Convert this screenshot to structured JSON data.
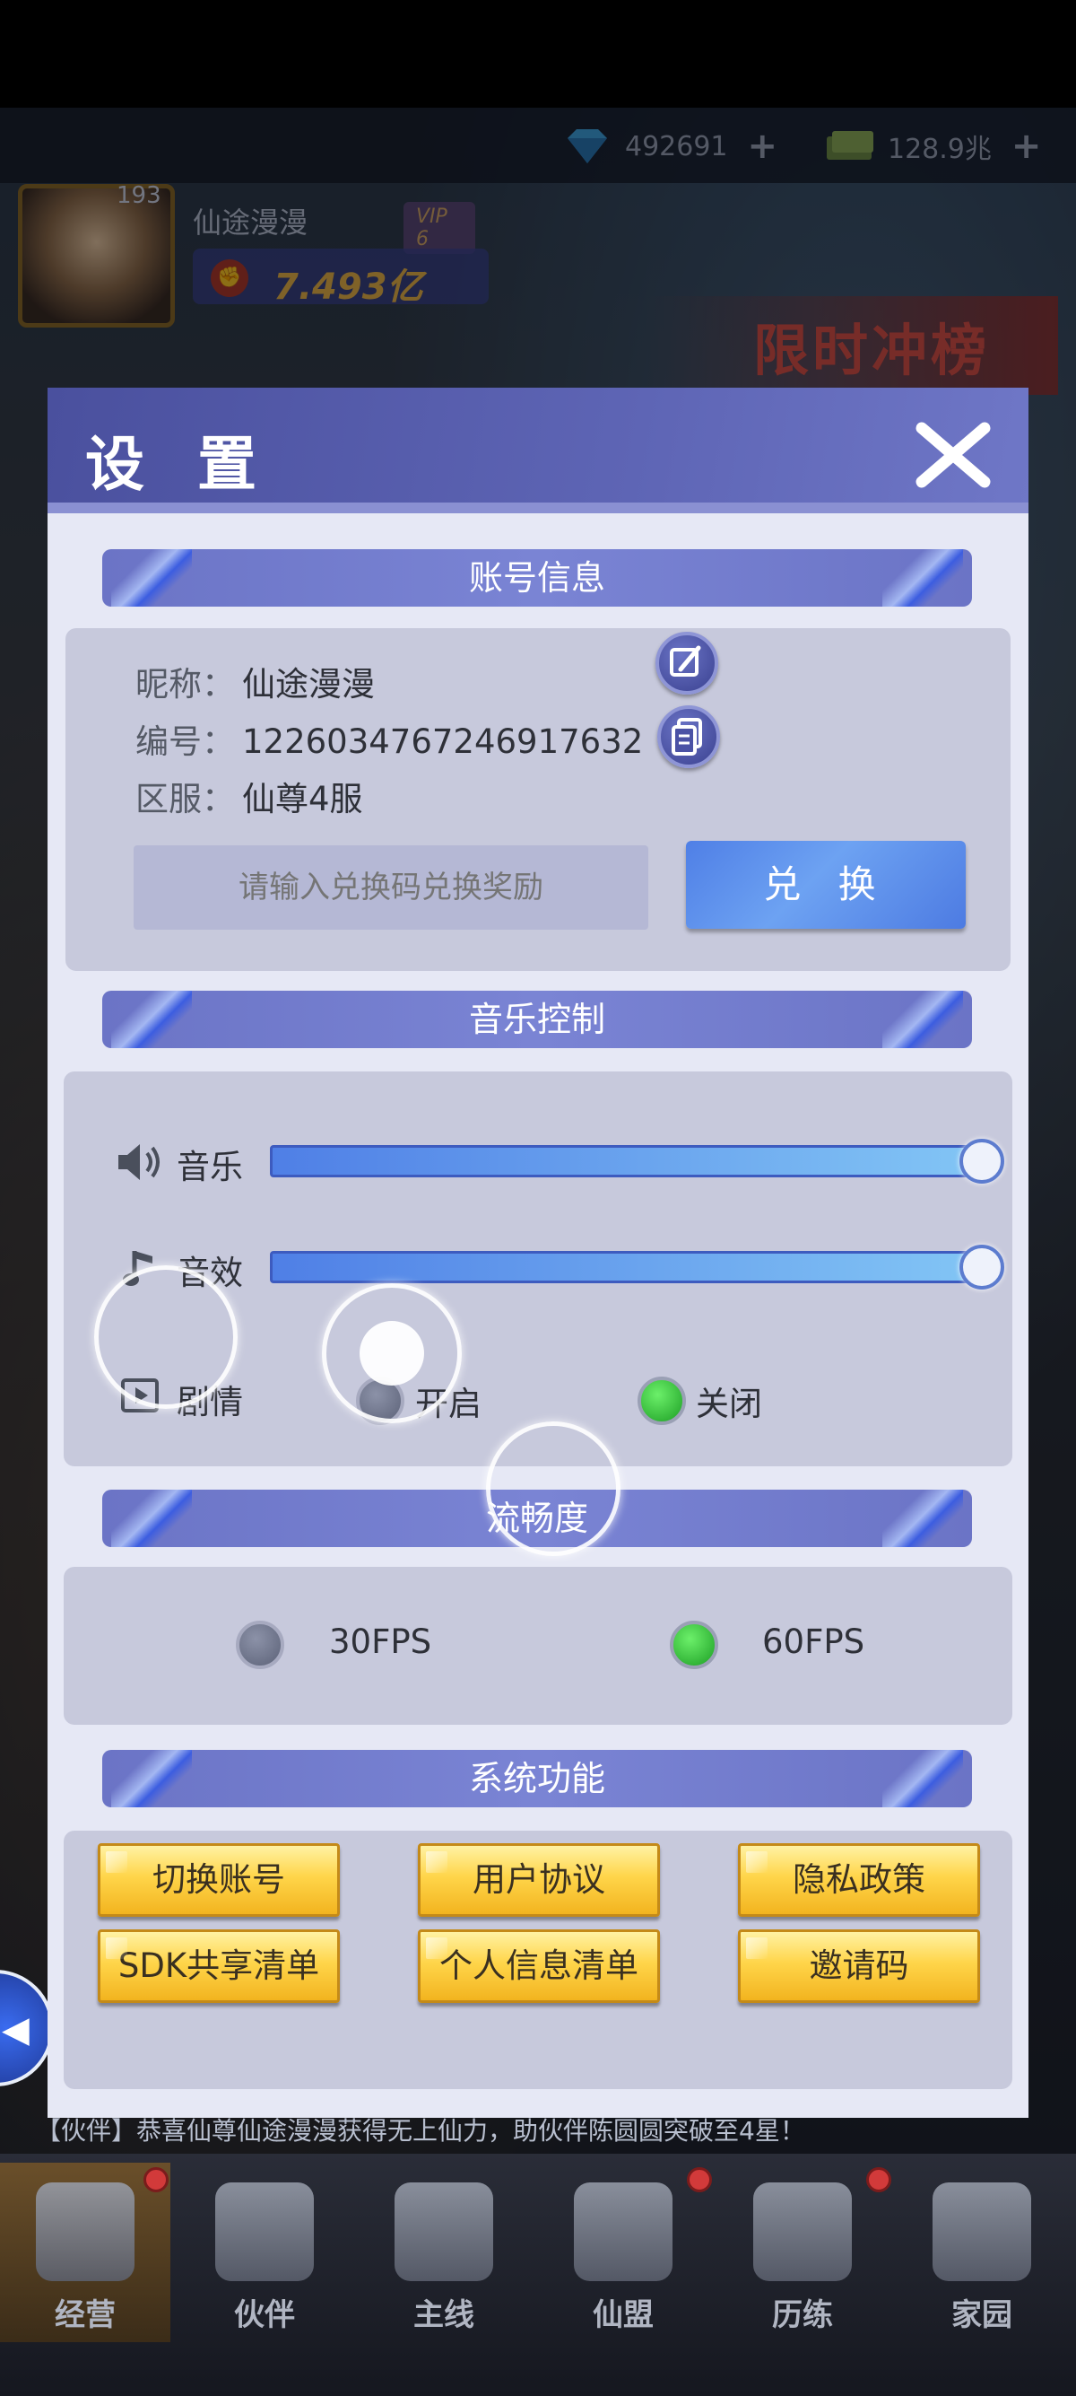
{
  "hud": {
    "diamonds": "492691",
    "cash": "128.9兆",
    "player": {
      "level": "193",
      "name": "仙途漫漫",
      "vip": "VIP 6",
      "power": "7.493亿"
    },
    "event_text": "限时冲榜"
  },
  "notice": "【伙伴】恭喜仙尊仙途漫漫获得无上仙力，助伙伴陈圆圆突破至4星！",
  "dialog": {
    "title": "设 置",
    "close_icon": "close-icon",
    "account": {
      "section_title": "账号信息",
      "nickname_label": "昵称：",
      "nickname_value": "仙途漫漫",
      "id_label": "编号：",
      "id_value": "1226034767246917632",
      "server_label": "区服：",
      "server_value": "仙尊4服",
      "code_placeholder": "请输入兑换码兑换奖励",
      "exchange_label": "兑 换"
    },
    "music": {
      "section_title": "音乐控制",
      "music_label": "音乐",
      "music_level": 1.0,
      "sfx_label": "音效",
      "sfx_level": 1.0,
      "story_label": "剧情",
      "story_on_label": "开启",
      "story_off_label": "关闭",
      "story_selected": "关闭"
    },
    "fluency": {
      "section_title": "流畅度",
      "fps30_label": "30FPS",
      "fps60_label": "60FPS",
      "selected": "60FPS"
    },
    "system": {
      "section_title": "系统功能",
      "buttons": [
        "切换账号",
        "用户协议",
        "隐私政策",
        "SDK共享清单",
        "个人信息清单",
        "邀请码"
      ]
    }
  },
  "bottom_nav": {
    "items": [
      {
        "label": "经营",
        "active": true
      },
      {
        "label": "伙伴"
      },
      {
        "label": "主线"
      },
      {
        "label": "仙盟"
      },
      {
        "label": "历练"
      },
      {
        "label": "家园"
      }
    ]
  },
  "colors": {
    "dialog_header": "#5e65b5",
    "section_bar": "#7a84d4",
    "panel": "#c7c9dc",
    "exchange_button": "#5a8ce8",
    "radio_selected": "#2ac02e",
    "system_button": "#ffd54a"
  }
}
